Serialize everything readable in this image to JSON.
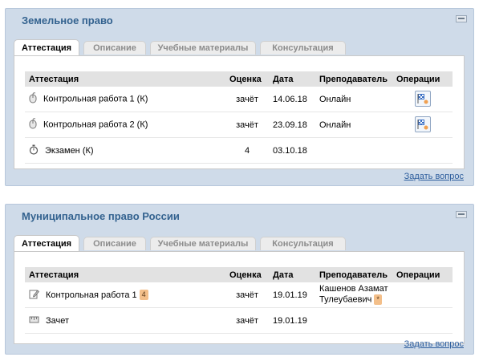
{
  "courses": [
    {
      "title": "Земельное право",
      "tabs": [
        "Аттестация",
        "Описание",
        "Учебные материалы",
        "Консультация"
      ],
      "headers": [
        "Аттестация",
        "Оценка",
        "Дата",
        "Преподаватель",
        "Операции"
      ],
      "rows": [
        {
          "name": "Контрольная работа 1 (К)",
          "grade": "зачёт",
          "date": "14.06.18",
          "teacher": "Онлайн",
          "icon": "mouse-icon"
        },
        {
          "name": "Контрольная работа 2 (К)",
          "grade": "зачёт",
          "date": "23.09.18",
          "teacher": "Онлайн",
          "icon": "mouse-icon"
        },
        {
          "name": "Экзамен (К)",
          "grade": "4",
          "date": "03.10.18",
          "teacher": "",
          "icon": "stopwatch-icon"
        }
      ],
      "ask_link": "Задать вопрос"
    },
    {
      "title": "Муниципальное право России",
      "tabs": [
        "Аттестация",
        "Описание",
        "Учебные материалы",
        "Консультация"
      ],
      "headers": [
        "Аттестация",
        "Оценка",
        "Дата",
        "Преподаватель",
        "Операции"
      ],
      "rows": [
        {
          "name": "Контрольная работа 1",
          "badge": "4",
          "grade": "зачёт",
          "date": "19.01.19",
          "teacher_line1": "Кашенов Азамат",
          "teacher_line2": "Тулеубаевич",
          "teacher_badge": "*",
          "icon": "edit-icon"
        },
        {
          "name": "Зачет",
          "grade": "зачёт",
          "date": "19.01.19",
          "teacher": "",
          "icon": "ruler-icon"
        }
      ],
      "ask_link": "Задать вопрос"
    }
  ],
  "colors": {
    "panel": "#cfdbe9",
    "title": "#33628f",
    "header": "#e2e2e2",
    "link": "#2f5f9e",
    "badge": "#f3bf8a"
  }
}
